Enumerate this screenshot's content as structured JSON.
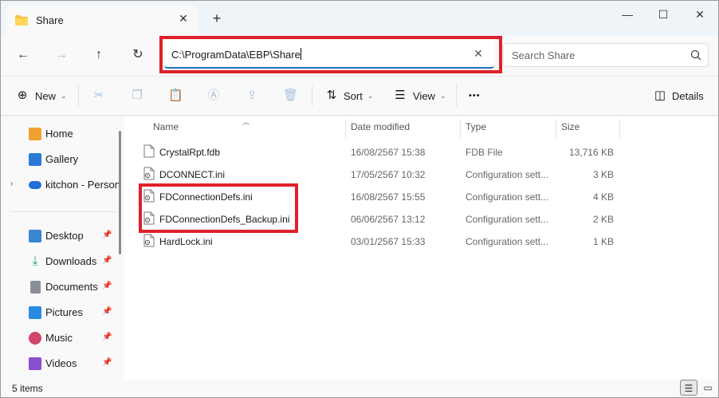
{
  "window": {
    "tab_title": "Share",
    "new_tab_label": "+",
    "minimize": "—",
    "maximize": "☐",
    "close": "✕"
  },
  "nav": {
    "back": "←",
    "forward": "→",
    "up": "↑",
    "refresh": "↻",
    "address": "C:\\ProgramData\\EBP\\Share",
    "address_clear": "✕",
    "search_placeholder": "Search Share"
  },
  "commands": {
    "new_label": "New",
    "sort_label": "Sort",
    "view_label": "View",
    "more_label": "•••",
    "details_label": "Details"
  },
  "sidebar": {
    "items": [
      {
        "label": "Home",
        "icon": "home-icon",
        "color": "#f0a030"
      },
      {
        "label": "Gallery",
        "icon": "gallery-icon",
        "color": "#2a7bd8"
      },
      {
        "label": "kitchon - Person",
        "icon": "onedrive-icon",
        "color": "#1f6fd8"
      }
    ],
    "quick": [
      {
        "label": "Desktop",
        "icon": "desktop-icon",
        "color": "#3a86d0"
      },
      {
        "label": "Downloads",
        "icon": "downloads-icon",
        "color": "#1aa36a"
      },
      {
        "label": "Documents",
        "icon": "documents-icon",
        "color": "#8a8f98"
      },
      {
        "label": "Pictures",
        "icon": "pictures-icon",
        "color": "#2a8ce0"
      },
      {
        "label": "Music",
        "icon": "music-icon",
        "color": "#d2456a"
      },
      {
        "label": "Videos",
        "icon": "videos-icon",
        "color": "#8a4fd0"
      }
    ],
    "pin_glyph": "📌"
  },
  "columns": {
    "name": "Name",
    "date": "Date modified",
    "type": "Type",
    "size": "Size"
  },
  "files": [
    {
      "name": "CrystalRpt.fdb",
      "date": "16/08/2567 15:38",
      "type": "FDB File",
      "size": "13,716 KB",
      "icon": "file-icon"
    },
    {
      "name": "DCONNECT.ini",
      "date": "17/05/2567 10:32",
      "type": "Configuration sett...",
      "size": "3 KB",
      "icon": "config-file-icon"
    },
    {
      "name": "FDConnectionDefs.ini",
      "date": "16/08/2567 15:55",
      "type": "Configuration sett...",
      "size": "4 KB",
      "icon": "config-file-icon"
    },
    {
      "name": "FDConnectionDefs_Backup.ini",
      "date": "06/06/2567 13:12",
      "type": "Configuration sett...",
      "size": "2 KB",
      "icon": "config-file-icon"
    },
    {
      "name": "HardLock.ini",
      "date": "03/01/2567 15:33",
      "type": "Configuration sett...",
      "size": "1 KB",
      "icon": "config-file-icon"
    }
  ],
  "status": {
    "item_count": "5 items"
  },
  "colors": {
    "highlight": "#e0202b",
    "accent": "#1f6fb8"
  }
}
